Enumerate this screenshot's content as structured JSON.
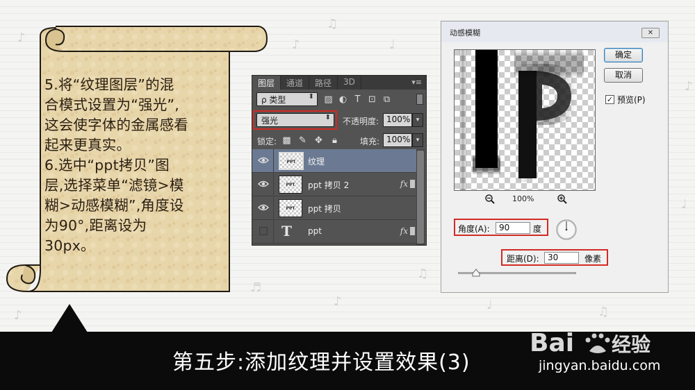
{
  "scroll": {
    "lines": [
      "5.将“纹理图层”的混",
      "合模式设置为“强光”,",
      "这会使字体的金属感看",
      "起来更真实。",
      "6.选中“ppt拷贝”图",
      "层,选择菜单“滤镜>模",
      "糊>动感模糊”,角度设",
      "为90°,距离设为",
      "30px。"
    ]
  },
  "layers_panel": {
    "tabs": [
      "图层",
      "通道",
      "路径",
      "3D"
    ],
    "menu_glyph": "▾≡",
    "filter_kind": "ρ 类型",
    "blend_mode": "强光",
    "opacity_label": "不透明度:",
    "opacity_value": "100%",
    "lock_label": "锁定:",
    "fill_label": "填充:",
    "fill_value": "100%",
    "layers": [
      {
        "name": "纹理",
        "thumb": "PPT",
        "selected": true,
        "visible": true,
        "fx": ""
      },
      {
        "name": "ppt 拷贝 2",
        "thumb": "PPT",
        "selected": false,
        "visible": true,
        "fx": "fx"
      },
      {
        "name": "ppt 拷贝",
        "thumb": "PPT",
        "selected": false,
        "visible": true,
        "fx": ""
      },
      {
        "name": "ppt",
        "thumb": "T",
        "selected": false,
        "visible": false,
        "fx": "fx"
      }
    ]
  },
  "dialog": {
    "title": "动感模糊",
    "close_glyph": "✕",
    "ok": "确定",
    "cancel": "取消",
    "preview_label": "预览(P)",
    "preview_checked": true,
    "zoom": "100%",
    "angle_label": "角度(A):",
    "angle_value": "90",
    "angle_unit": "度",
    "distance_label": "距离(D):",
    "distance_value": "30",
    "distance_unit": "像素",
    "highlight_color": "#d32a24"
  },
  "caption": "第五步:添加纹理并设置效果(3)",
  "watermark": {
    "logo_text": "Bai",
    "logo_suffix": "经验",
    "url": "jingyan.baidu.com"
  }
}
